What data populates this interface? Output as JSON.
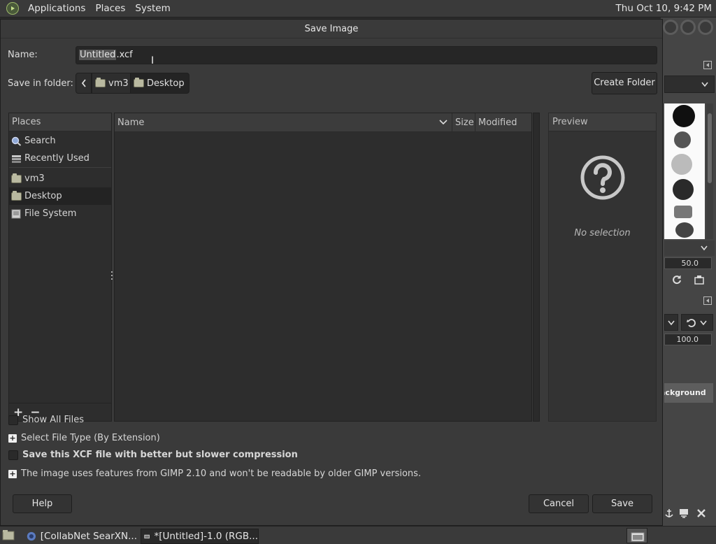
{
  "top_panel": {
    "menus": [
      "Applications",
      "Places",
      "System"
    ],
    "clock": "Thu Oct 10,  9:42 PM"
  },
  "dialog": {
    "title": "Save Image",
    "name_label": "Name:",
    "name_value_selected": "Untitled",
    "name_value_ext": ".xcf",
    "folder_label": "Save in folder:",
    "breadcrumbs": [
      "vm3",
      "Desktop"
    ],
    "create_folder": "Create Folder",
    "places": {
      "header": "Places",
      "items": [
        {
          "label": "Search",
          "icon": "search-icon"
        },
        {
          "label": "Recently Used",
          "icon": "recent-icon"
        },
        {
          "label": "vm3",
          "icon": "home-folder-icon"
        },
        {
          "label": "Desktop",
          "icon": "desktop-folder-icon",
          "selected": true
        },
        {
          "label": "File System",
          "icon": "drive-icon"
        }
      ],
      "add": "+",
      "remove": "−"
    },
    "file_list": {
      "columns": [
        "Name",
        "Size",
        "Modified"
      ],
      "rows": []
    },
    "preview": {
      "header": "Preview",
      "empty_text": "No selection",
      "icon": "question-icon"
    },
    "options": {
      "show_all_files": "Show All Files",
      "select_file_type": "Select File Type (By Extension)",
      "better_compression": "Save this XCF file with better but slower compression",
      "compat_notice": "The image uses features from GIMP 2.10 and won't be readable by older GIMP versions."
    },
    "buttons": {
      "help": "Help",
      "cancel": "Cancel",
      "save": "Save"
    }
  },
  "background_window": {
    "size_value": "50.0",
    "opacity_value": "100.0",
    "layer_name": "ackground"
  },
  "taskbar": {
    "tasks": [
      {
        "label": "[CollabNet SearXN...",
        "icon": "browser-icon"
      },
      {
        "label": "*[Untitled]-1.0 (RGB...",
        "icon": "gimp-window-icon",
        "active": true
      }
    ]
  },
  "colors": {
    "dialog_bg": "#3a3a3a",
    "panel_bg": "#3a3a3a",
    "pane_bg": "#2d2d2d",
    "text": "#dcdcdc"
  }
}
